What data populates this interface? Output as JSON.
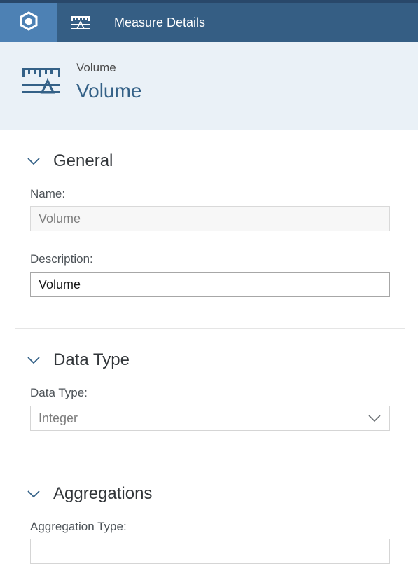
{
  "topbar": {
    "home_icon": "cube-icon",
    "tab_icon": "ruler-scale-icon",
    "tab_label": "Measure Details"
  },
  "header": {
    "icon": "ruler-scale-icon",
    "subtitle": "Volume",
    "title": "Volume"
  },
  "sections": {
    "general": {
      "title": "General",
      "name_label": "Name:",
      "name_value": "Volume",
      "description_label": "Description:",
      "description_value": "Volume"
    },
    "data_type": {
      "title": "Data Type",
      "label": "Data Type:",
      "value": "Integer"
    },
    "aggregations": {
      "title": "Aggregations",
      "label": "Aggregation Type:"
    }
  },
  "colors": {
    "shell": "#355e84",
    "home": "#4d81b4",
    "header_bg": "#eaf1f7",
    "accent": "#346187"
  }
}
